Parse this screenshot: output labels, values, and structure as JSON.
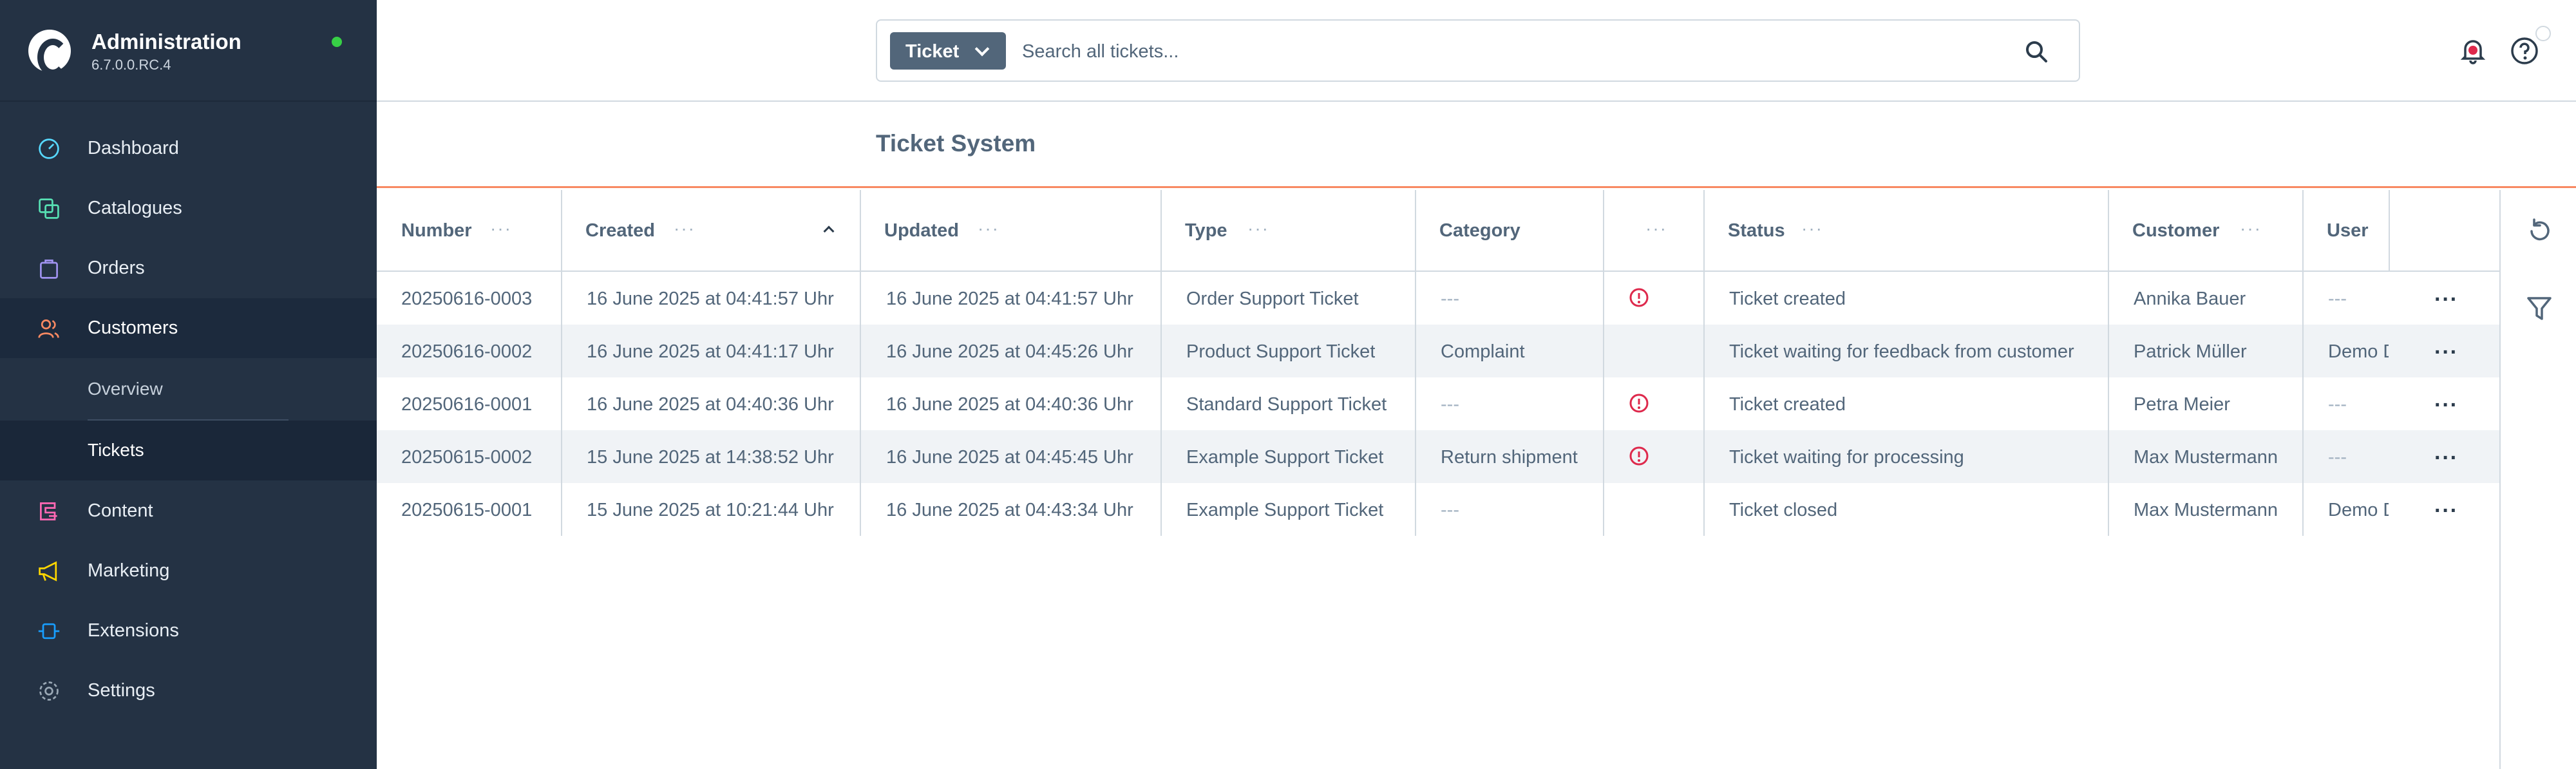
{
  "app": {
    "title": "Administration",
    "version": "6.7.0.0.RC.4",
    "status_color": "#37d046"
  },
  "sidebar": {
    "items": [
      {
        "label": "Dashboard",
        "icon": "dashboard-icon",
        "color": "#57d9ff"
      },
      {
        "label": "Catalogues",
        "icon": "catalogue-icon",
        "color": "#57e0b3"
      },
      {
        "label": "Orders",
        "icon": "orders-icon",
        "color": "#a092f0"
      },
      {
        "label": "Customers",
        "icon": "customers-icon",
        "color": "#f88962"
      },
      {
        "label": "Content",
        "icon": "content-icon",
        "color": "#ff68b4"
      },
      {
        "label": "Marketing",
        "icon": "marketing-icon",
        "color": "#ffd700"
      },
      {
        "label": "Extensions",
        "icon": "extensions-icon",
        "color": "#189eff"
      },
      {
        "label": "Settings",
        "icon": "settings-icon",
        "color": "#9aa8b5"
      }
    ],
    "customers_sub": [
      {
        "label": "Overview"
      },
      {
        "label": "Tickets"
      }
    ]
  },
  "topbar": {
    "search_type": "Ticket",
    "search_placeholder": "Search all tickets..."
  },
  "page": {
    "title": "Ticket System"
  },
  "table": {
    "columns": [
      {
        "label": "Number"
      },
      {
        "label": "Created"
      },
      {
        "label": "Updated"
      },
      {
        "label": "Type"
      },
      {
        "label": "Category"
      },
      {
        "label": ""
      },
      {
        "label": "Status"
      },
      {
        "label": "Customer"
      },
      {
        "label": "User"
      }
    ],
    "rows": [
      {
        "number": "20250616-0003",
        "created": "16 June 2025 at 04:41:57 Uhr",
        "updated": "16 June 2025 at 04:41:57 Uhr",
        "type": "Order Support Ticket",
        "category": "---",
        "warning": true,
        "status": "Ticket created",
        "customer": "Annika Bauer",
        "user": "---"
      },
      {
        "number": "20250616-0002",
        "created": "16 June 2025 at 04:41:17 Uhr",
        "updated": "16 June 2025 at 04:45:26 Uhr",
        "type": "Product Support Ticket",
        "category": "Complaint",
        "warning": false,
        "status": "Ticket waiting for feedback from customer",
        "customer": "Patrick Müller",
        "user": "Demo D"
      },
      {
        "number": "20250616-0001",
        "created": "16 June 2025 at 04:40:36 Uhr",
        "updated": "16 June 2025 at 04:40:36 Uhr",
        "type": "Standard Support Ticket",
        "category": "---",
        "warning": true,
        "status": "Ticket created",
        "customer": "Petra Meier",
        "user": "---"
      },
      {
        "number": "20250615-0002",
        "created": "15 June 2025 at 14:38:52 Uhr",
        "updated": "16 June 2025 at 04:45:45 Uhr",
        "type": "Example Support Ticket",
        "category": "Return shipment",
        "warning": true,
        "status": "Ticket waiting for processing",
        "customer": "Max Mustermann",
        "user": "---"
      },
      {
        "number": "20250615-0001",
        "created": "15 June 2025 at 10:21:44 Uhr",
        "updated": "16 June 2025 at 04:43:34 Uhr",
        "type": "Example Support Ticket",
        "category": "---",
        "warning": false,
        "status": "Ticket closed",
        "customer": "Max Mustermann",
        "user": "Demo D"
      }
    ]
  },
  "icons": {
    "search": "search-icon",
    "notifications": "bell-icon",
    "help": "help-icon",
    "refresh": "refresh-icon",
    "filter": "filter-icon",
    "warning": "warning-icon",
    "row_actions": "more-icon"
  }
}
